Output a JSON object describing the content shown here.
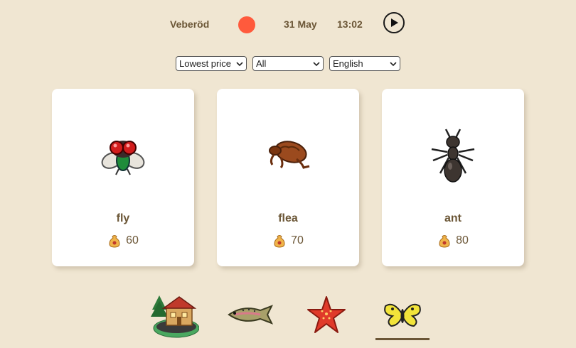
{
  "header": {
    "location": "Veberöd",
    "date": "31 May",
    "time": "13:02",
    "status_color": "#ff5a3c"
  },
  "filters": {
    "sort": "Lowest price",
    "category": "All",
    "language": "English"
  },
  "cards": [
    {
      "name": "fly",
      "price": "60",
      "icon": "fly-icon"
    },
    {
      "name": "flea",
      "price": "70",
      "icon": "flea-icon"
    },
    {
      "name": "ant",
      "price": "80",
      "icon": "ant-icon"
    }
  ],
  "nav": {
    "items": [
      {
        "icon": "museum-house-icon"
      },
      {
        "icon": "fish-icon"
      },
      {
        "icon": "starfish-icon"
      },
      {
        "icon": "butterfly-icon",
        "active": true
      }
    ]
  },
  "colors": {
    "background": "#f0e6d2",
    "text": "#6b5636",
    "card": "#ffffff"
  }
}
